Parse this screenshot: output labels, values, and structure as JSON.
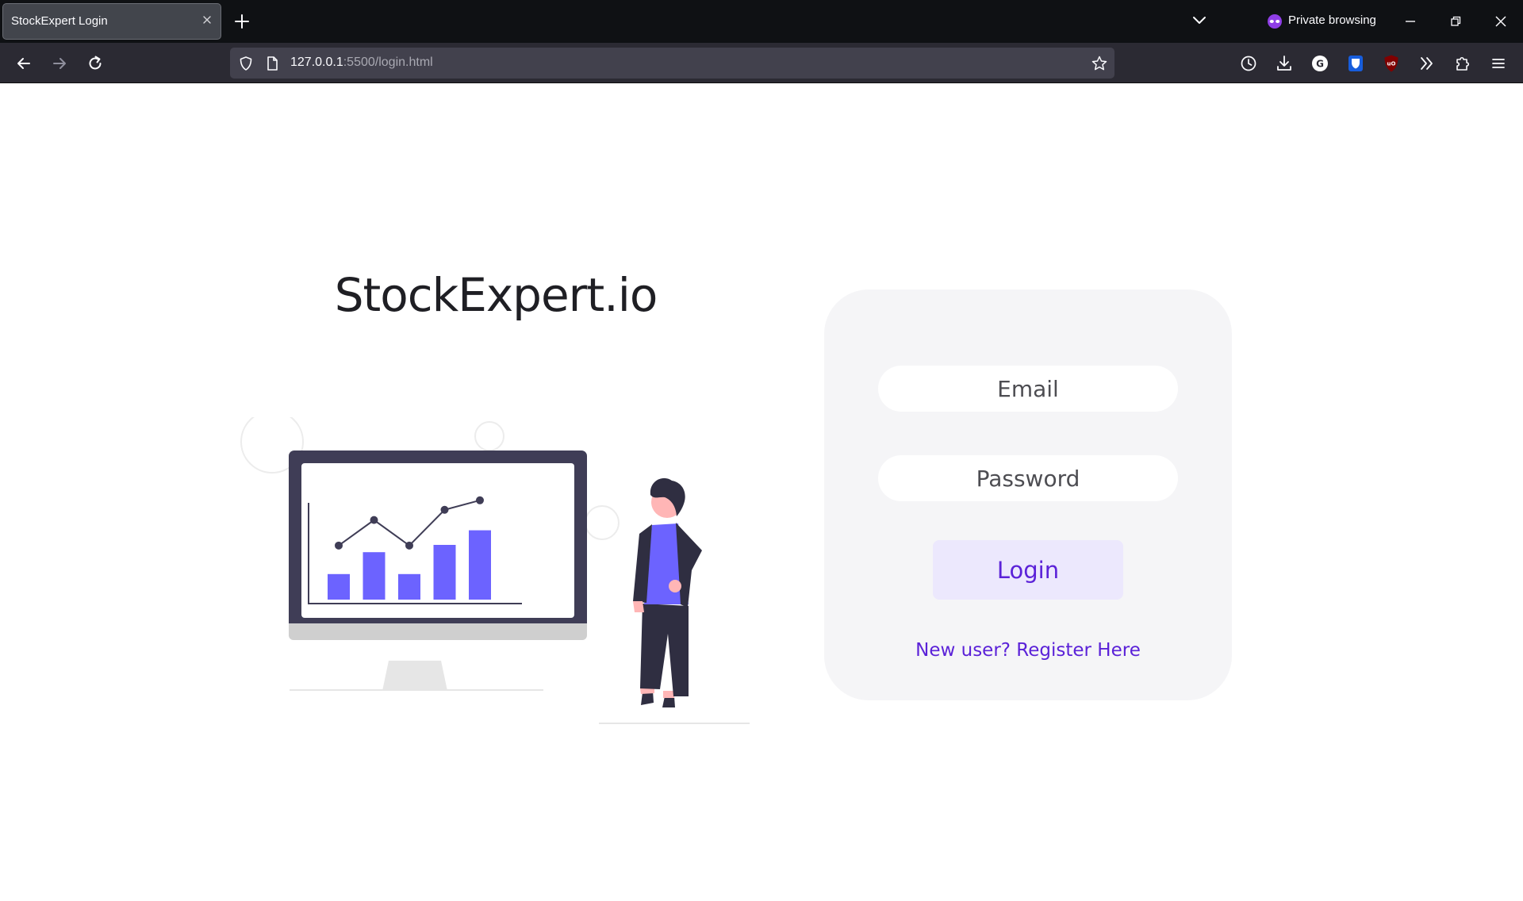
{
  "browser": {
    "tab_title": "StockExpert Login",
    "private_label": "Private browsing",
    "url_host": "127.0.0.1",
    "url_path": ":5500/login.html"
  },
  "page": {
    "brand": "StockExpert.io",
    "email_placeholder": "Email",
    "password_placeholder": "Password",
    "login_label": "Login",
    "register_link": "New user? Register Here"
  },
  "illustration": {
    "bar_levels": [
      0.35,
      0.65,
      0.35,
      0.75,
      0.95
    ],
    "line_levels": [
      0.48,
      0.83,
      0.48,
      0.97,
      1.1
    ]
  },
  "colors": {
    "accent": "#5b22d8",
    "bars": "#6c63ff",
    "card": "#f5f5f7",
    "chrome_dark": "#0f1114",
    "chrome_nav": "#2b2a33"
  },
  "icons": {
    "tab_close": "close-icon",
    "new_tab": "plus-icon",
    "tab_list": "chevron-down-icon",
    "private": "private-mask-icon",
    "back": "arrow-left-icon",
    "forward": "arrow-right-icon",
    "reload": "reload-icon",
    "shield": "shield-icon",
    "page": "page-icon",
    "bookmark": "star-icon",
    "history": "clock-icon",
    "downloads": "download-icon",
    "grammarly": "grammarly-icon",
    "bitwarden": "bitwarden-icon",
    "ublock": "ublock-icon",
    "overflow": "chevrons-right-icon",
    "extensions": "puzzle-icon",
    "menu": "hamburger-icon"
  }
}
